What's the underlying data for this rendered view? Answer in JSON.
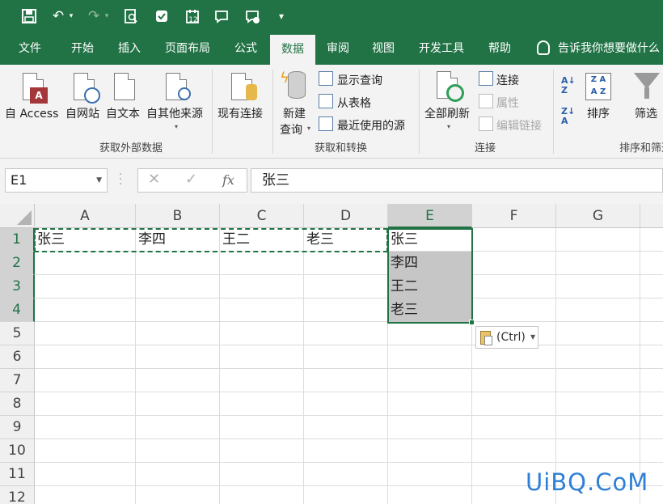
{
  "quick_access": {
    "icons": [
      "save-icon",
      "undo-icon",
      "redo-icon",
      "print-preview-icon",
      "spell-check-icon",
      "calendar-icon",
      "comment-icon",
      "comment-delete-icon",
      "customize-icon"
    ],
    "calendar_number": "12"
  },
  "tabs": [
    "文件",
    "开始",
    "插入",
    "页面布局",
    "公式",
    "数据",
    "审阅",
    "视图",
    "开发工具",
    "帮助"
  ],
  "active_tab": "数据",
  "tell_me": "告诉我你想要做什么",
  "ribbon": {
    "groups": {
      "get_external": {
        "label": "获取外部数据",
        "from_access": "自 Access",
        "from_web": "自网站",
        "from_text": "自文本",
        "from_other": "自其他来源",
        "existing_connections": "现有连接"
      },
      "get_transform": {
        "label": "获取和转换",
        "new_query_line1": "新建",
        "new_query_line2": "查询",
        "show_queries": "显示查询",
        "from_table": "从表格",
        "recent_sources": "最近使用的源"
      },
      "connections": {
        "label": "连接",
        "refresh_all": "全部刷新",
        "connections": "连接",
        "properties": "属性",
        "edit_links": "编辑链接"
      },
      "sort_filter": {
        "label": "排序和筛选",
        "sort": "排序",
        "filter": "筛选"
      }
    }
  },
  "formula_bar": {
    "name_box": "E1",
    "cancel": "✕",
    "enter": "✓",
    "fx": "fx",
    "content": "张三"
  },
  "sheet": {
    "columns": [
      "A",
      "B",
      "C",
      "D",
      "E",
      "F",
      "G"
    ],
    "selected_column": "E",
    "rows": [
      "1",
      "2",
      "3",
      "4",
      "5",
      "6",
      "7",
      "8",
      "9",
      "10",
      "11",
      "12"
    ],
    "cells": {
      "A1": "张三",
      "B1": "李四",
      "C1": "王二",
      "D1": "老三",
      "E1": "张三",
      "E2": "李四",
      "E3": "王二",
      "E4": "老三"
    },
    "paste_options": "(Ctrl)"
  },
  "watermark": "UiBQ.CoM",
  "colors": {
    "accent": "#217346",
    "selection_fill": "#c6c6c6",
    "watermark": "#2f7fd6"
  }
}
